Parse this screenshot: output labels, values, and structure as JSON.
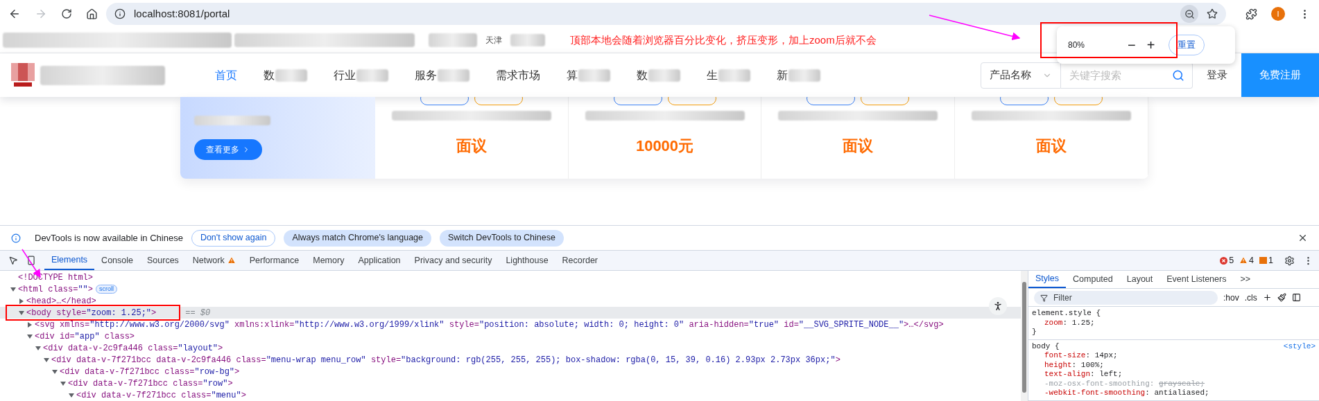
{
  "browser": {
    "url": "localhost:8081/portal",
    "back_disabled": false,
    "forward_disabled": true,
    "profile_initial": "I"
  },
  "annotation": {
    "text": "顶部本地会随着浏览器百分比变化，挤压变形，加上zoom后就不会"
  },
  "zoom_popup": {
    "level_text": "80%",
    "minus": "−",
    "plus": "+",
    "reset": "重置"
  },
  "bookmarks": [
    {
      "label": "天津"
    }
  ],
  "nav": {
    "items": [
      {
        "label": "首页",
        "selected": true,
        "blurred": false
      },
      {
        "label": "数",
        "selected": false,
        "blurred": true
      },
      {
        "label": "行业",
        "selected": false,
        "blurred": true
      },
      {
        "label": "服务",
        "selected": false,
        "blurred": true
      },
      {
        "label": "需求市场",
        "selected": false,
        "blurred": false
      },
      {
        "label": "算",
        "selected": false,
        "blurred": true
      },
      {
        "label": "数",
        "selected": false,
        "blurred": true
      },
      {
        "label": "生",
        "selected": false,
        "blurred": true
      },
      {
        "label": "新",
        "selected": false,
        "blurred": true
      }
    ],
    "search_category": "产品名称",
    "search_placeholder": "关键字搜索",
    "login": "登录",
    "register": "免费注册"
  },
  "promo": {
    "button": "查看更多",
    "cards": [
      {
        "price": "面议",
        "tags": [
          {
            "color": "#3b82f6"
          },
          {
            "color": "#f59e0b"
          }
        ]
      },
      {
        "price": "10000元",
        "tags": [
          {
            "color": "#3b82f6"
          },
          {
            "color": "#f59e0b"
          }
        ]
      },
      {
        "price": "面议",
        "tags": [
          {
            "color": "#3b82f6"
          },
          {
            "color": "#f59e0b"
          }
        ]
      },
      {
        "price": "面议",
        "tags": [
          {
            "color": "#3b82f6"
          },
          {
            "color": "#f59e0b"
          }
        ]
      }
    ]
  },
  "devtools": {
    "banner": {
      "text": "DevTools is now available in Chinese",
      "buttons": [
        {
          "label": "Don't show again",
          "kind": "outline"
        },
        {
          "label": "Always match Chrome's language",
          "kind": "filled"
        },
        {
          "label": "Switch DevTools to Chinese",
          "kind": "filled"
        }
      ]
    },
    "tabs": [
      {
        "label": "Elements",
        "selected": true,
        "warning": false
      },
      {
        "label": "Console",
        "selected": false,
        "warning": false
      },
      {
        "label": "Sources",
        "selected": false,
        "warning": false
      },
      {
        "label": "Network",
        "selected": false,
        "warning": true
      },
      {
        "label": "Performance",
        "selected": false,
        "warning": false
      },
      {
        "label": "Memory",
        "selected": false,
        "warning": false
      },
      {
        "label": "Application",
        "selected": false,
        "warning": false
      },
      {
        "label": "Privacy and security",
        "selected": false,
        "warning": false
      },
      {
        "label": "Lighthouse",
        "selected": false,
        "warning": false
      },
      {
        "label": "Recorder",
        "selected": false,
        "warning": false
      }
    ],
    "counts": {
      "errors": "5",
      "warnings": "4",
      "infos": "1"
    },
    "tree": [
      {
        "text": "<!DOCTYPE html>",
        "selected": false
      },
      {
        "text": "<html class=\"\">",
        "badge": "scroll",
        "expanded": true,
        "selected": false,
        "children": [
          {
            "text": "<head>…</head>",
            "expanded": false,
            "selected": false
          },
          {
            "text": "<body style=\"zoom: 1.25;\">",
            "suffix": "== $0",
            "expanded": true,
            "selected": true,
            "children": [
              {
                "text": "<svg xmlns=\"http://www.w3.org/2000/svg\" xmlns:xlink=\"http://www.w3.org/1999/xlink\" style=\"position: absolute; width: 0; height: 0\" aria-hidden=\"true\" id=\"__SVG_SPRITE_NODE__\">…</svg>",
                "expanded": false,
                "selected": false
              },
              {
                "text": "<div id=\"app\" class>",
                "expanded": true,
                "selected": false,
                "children": [
                  {
                    "text": "<div data-v-2c9fa446 class=\"layout\">",
                    "expanded": true,
                    "selected": false,
                    "children": [
                      {
                        "text": "<div data-v-7f271bcc data-v-2c9fa446 class=\"menu-wrap menu_row\" style=\"background: rgb(255, 255, 255); box-shadow: rgba(0, 15, 39, 0.16) 2.93px 2.73px 36px;\">",
                        "expanded": true,
                        "selected": false,
                        "children": [
                          {
                            "text": "<div data-v-7f271bcc class=\"row-bg\">",
                            "expanded": true,
                            "selected": false,
                            "children": [
                              {
                                "text": "<div data-v-7f271bcc class=\"row\">",
                                "expanded": true,
                                "selected": false,
                                "children": [
                                  {
                                    "text": "<div data-v-7f271bcc class=\"menu\">",
                                    "expanded": true,
                                    "selected": false
                                  }
                                ]
                              }
                            ]
                          }
                        ]
                      }
                    ]
                  }
                ]
              }
            ]
          }
        ]
      }
    ],
    "side_tabs": [
      {
        "label": "Styles",
        "selected": true
      },
      {
        "label": "Computed",
        "selected": false
      },
      {
        "label": "Layout",
        "selected": false
      },
      {
        "label": "Event Listeners",
        "selected": false
      },
      {
        "label": ">>",
        "selected": false
      }
    ],
    "filter_placeholder": "Filter",
    "hov": ":hov",
    "cls": ".cls",
    "rules": [
      {
        "selector": "element.style {",
        "close": "}",
        "decls": [
          {
            "prop": "zoom:",
            "value": "1.25;",
            "overridden": false
          }
        ]
      },
      {
        "selector": "body {",
        "source": "<style>",
        "decls": [
          {
            "prop": "font-size:",
            "value": "14px;",
            "overridden": false
          },
          {
            "prop": "height:",
            "value": "100%;",
            "overridden": false
          },
          {
            "prop": "text-align:",
            "value": "left;",
            "overridden": false
          },
          {
            "prop": "-moz-osx-font-smoothing:",
            "value": "grayscale;",
            "overridden": true
          },
          {
            "prop": "-webkit-font-smoothing:",
            "value": "antialiased;",
            "overridden": false
          }
        ]
      }
    ]
  }
}
